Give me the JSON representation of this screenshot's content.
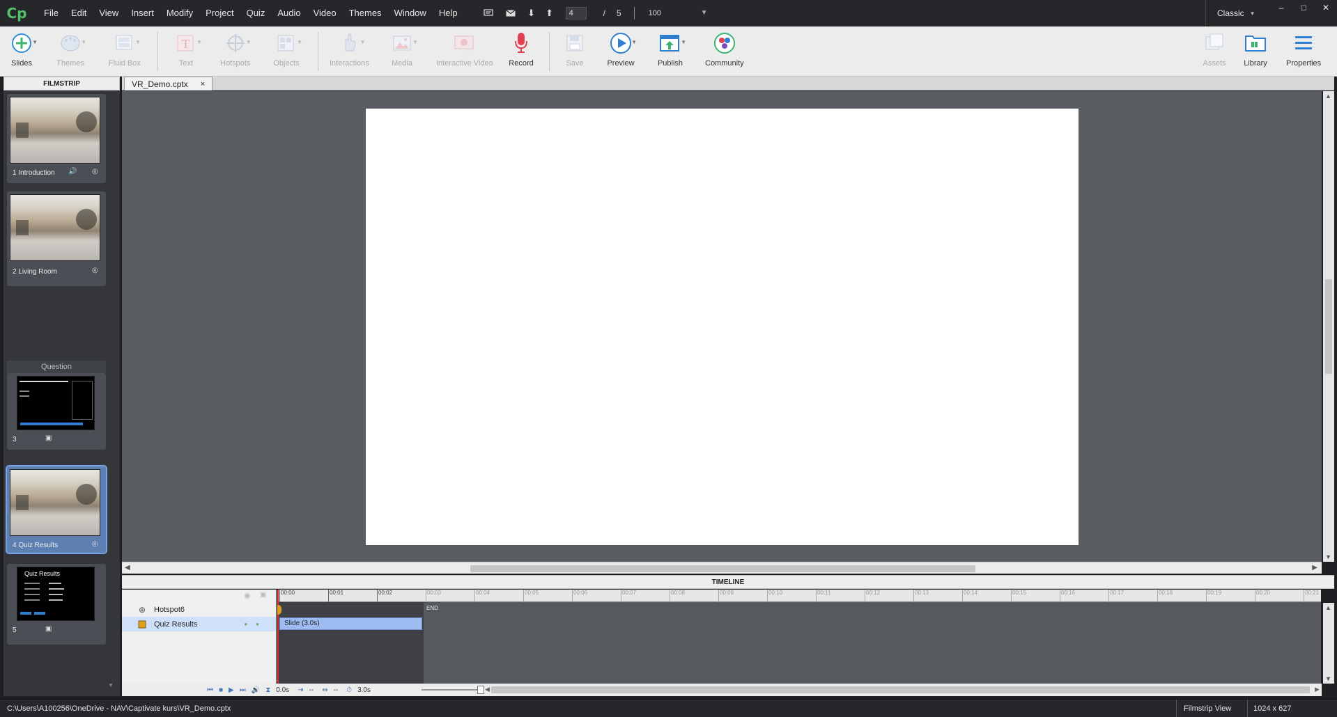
{
  "app": {
    "logo": "Cp"
  },
  "menubar": {
    "items": [
      "File",
      "Edit",
      "View",
      "Insert",
      "Modify",
      "Project",
      "Quiz",
      "Audio",
      "Video",
      "Themes",
      "Window",
      "Help"
    ],
    "slide_current": "4",
    "slide_separator": "/",
    "slide_total": "5",
    "zoom": "100",
    "workspace": "Classic"
  },
  "toolbar": {
    "slides": "Slides",
    "themes": "Themes",
    "fluid_box": "Fluid Box",
    "text": "Text",
    "hotspots": "Hotspots",
    "objects": "Objects",
    "interactions": "Interactions",
    "media": "Media",
    "interactive_video": "Interactive Video",
    "record": "Record",
    "save": "Save",
    "preview": "Preview",
    "publish": "Publish",
    "community": "Community",
    "assets": "Assets",
    "library": "Library",
    "properties": "Properties"
  },
  "filmstrip": {
    "header": "FILMSTRIP",
    "question_label": "Question",
    "slides": [
      {
        "name": "1 Introduction"
      },
      {
        "name": "2 Living Room"
      },
      {
        "name": "3"
      },
      {
        "name": "4 Quiz Results"
      },
      {
        "name": "5"
      }
    ],
    "quiz_results_title": "Quiz Results"
  },
  "document": {
    "tab": "VR_Demo.cptx",
    "close": "×"
  },
  "timeline": {
    "header": "TIMELINE",
    "layers": [
      {
        "name": "Hotspot6"
      },
      {
        "name": "Quiz Results"
      }
    ],
    "ticks": [
      "00:00",
      "00:01",
      "00:02",
      "00:03",
      "00:04",
      "00:05",
      "00:06",
      "00:07",
      "00:08",
      "00:09",
      "00:10",
      "00:11",
      "00:12",
      "00:13",
      "00:14",
      "00:15",
      "00:16",
      "00:17",
      "00:18",
      "00:19",
      "00:20",
      "00:21"
    ],
    "slide_bar": "Slide (3.0s)",
    "end_label": "END",
    "current_time": "0.0s",
    "in_time": "--",
    "out_time": "--",
    "duration": "3.0s"
  },
  "statusbar": {
    "path": "C:\\Users\\A100256\\OneDrive - NAV\\Captivate kurs\\VR_Demo.cptx",
    "view": "Filmstrip View",
    "size": "1024 x 627"
  }
}
